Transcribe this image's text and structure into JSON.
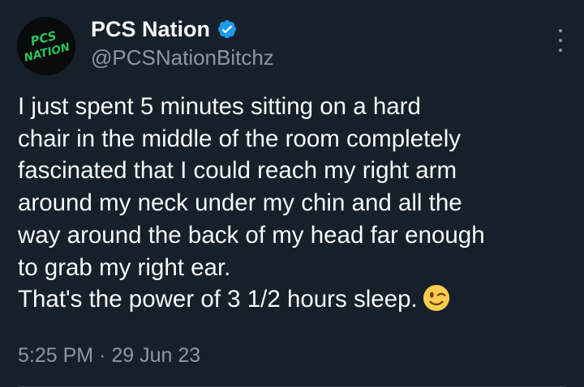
{
  "author": {
    "display_name": "PCS Nation",
    "handle": "@PCSNationBitchz",
    "verified": true,
    "avatar_text": [
      "PCS",
      "NATION"
    ],
    "avatar_text_color": "#22c55e"
  },
  "tweet": {
    "lines": [
      "I just spent 5 minutes sitting on a hard",
      "chair in the middle of the room completely",
      "fascinated that I could reach my right arm",
      "around my neck under my chin and all the",
      "way around the back of my head far enough",
      "to grab my right ear.",
      "That's the power of 3 1/2 hours sleep."
    ],
    "emoji": "wink-emoji",
    "timestamp": "5:25 PM · 29 Jun 23"
  },
  "colors": {
    "background": "#15202b",
    "primary_text": "#f7f9f9",
    "secondary_text": "#8b98a5",
    "verified_badge": "#1d9bf0",
    "divider": "#38444d"
  },
  "icons": {
    "verified": "verified-badge-icon",
    "more": "more-options-icon"
  }
}
